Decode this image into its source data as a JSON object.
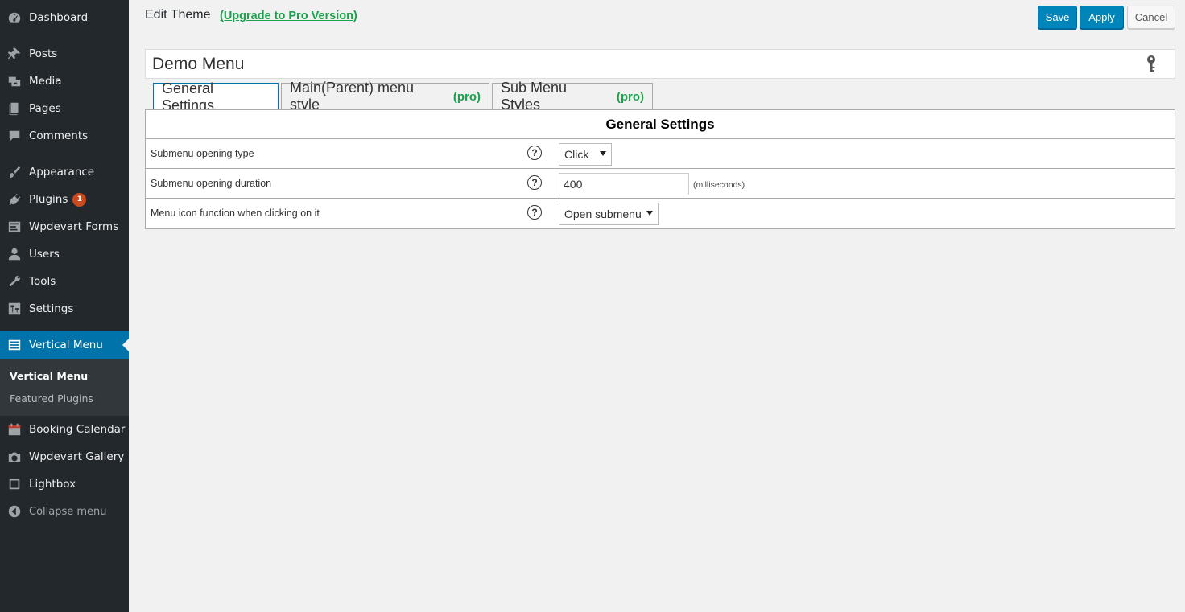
{
  "sidebar": {
    "items": [
      {
        "label": "Dashboard",
        "icon": "dashboard-icon"
      },
      {
        "label": "Posts",
        "icon": "pin-icon"
      },
      {
        "label": "Media",
        "icon": "media-icon"
      },
      {
        "label": "Pages",
        "icon": "pages-icon"
      },
      {
        "label": "Comments",
        "icon": "comments-icon"
      },
      {
        "label": "Appearance",
        "icon": "brush-icon"
      },
      {
        "label": "Plugins",
        "icon": "plug-icon",
        "badge": "1"
      },
      {
        "label": "Wpdevart Forms",
        "icon": "forms-icon"
      },
      {
        "label": "Users",
        "icon": "user-icon"
      },
      {
        "label": "Tools",
        "icon": "wrench-icon"
      },
      {
        "label": "Settings",
        "icon": "settings-icon"
      },
      {
        "label": "Vertical Menu",
        "icon": "list-icon"
      },
      {
        "label": "Booking Calendar",
        "icon": "calendar-icon"
      },
      {
        "label": "Wpdevart Gallery",
        "icon": "camera-icon"
      },
      {
        "label": "Lightbox",
        "icon": "lightbox-icon"
      },
      {
        "label": "Collapse menu",
        "icon": "collapse-icon"
      }
    ],
    "submenu": [
      {
        "label": "Vertical Menu"
      },
      {
        "label": "Featured Plugins"
      }
    ]
  },
  "header": {
    "title": "Edit Theme",
    "upgrade_link": "(Upgrade to Pro Version)",
    "save_label": "Save",
    "apply_label": "Apply",
    "cancel_label": "Cancel"
  },
  "theme": {
    "name": "Demo Menu"
  },
  "tabs": [
    {
      "label": "General Settings",
      "pro": ""
    },
    {
      "label": "Main(Parent) menu style",
      "pro": "(pro)"
    },
    {
      "label": "Sub Menu Styles",
      "pro": "(pro)"
    }
  ],
  "settings": {
    "heading": "General Settings",
    "rows": [
      {
        "label": "Submenu opening type",
        "value": "Click"
      },
      {
        "label": "Submenu opening duration",
        "value": "400",
        "unit": "(milliseconds)"
      },
      {
        "label": "Menu icon function when clicking on it",
        "value": "Open submenu"
      }
    ]
  },
  "colors": {
    "sidebar_bg": "#23282d",
    "accent": "#0073aa",
    "pro_green": "#1aa14b",
    "badge": "#ca4a1f"
  }
}
